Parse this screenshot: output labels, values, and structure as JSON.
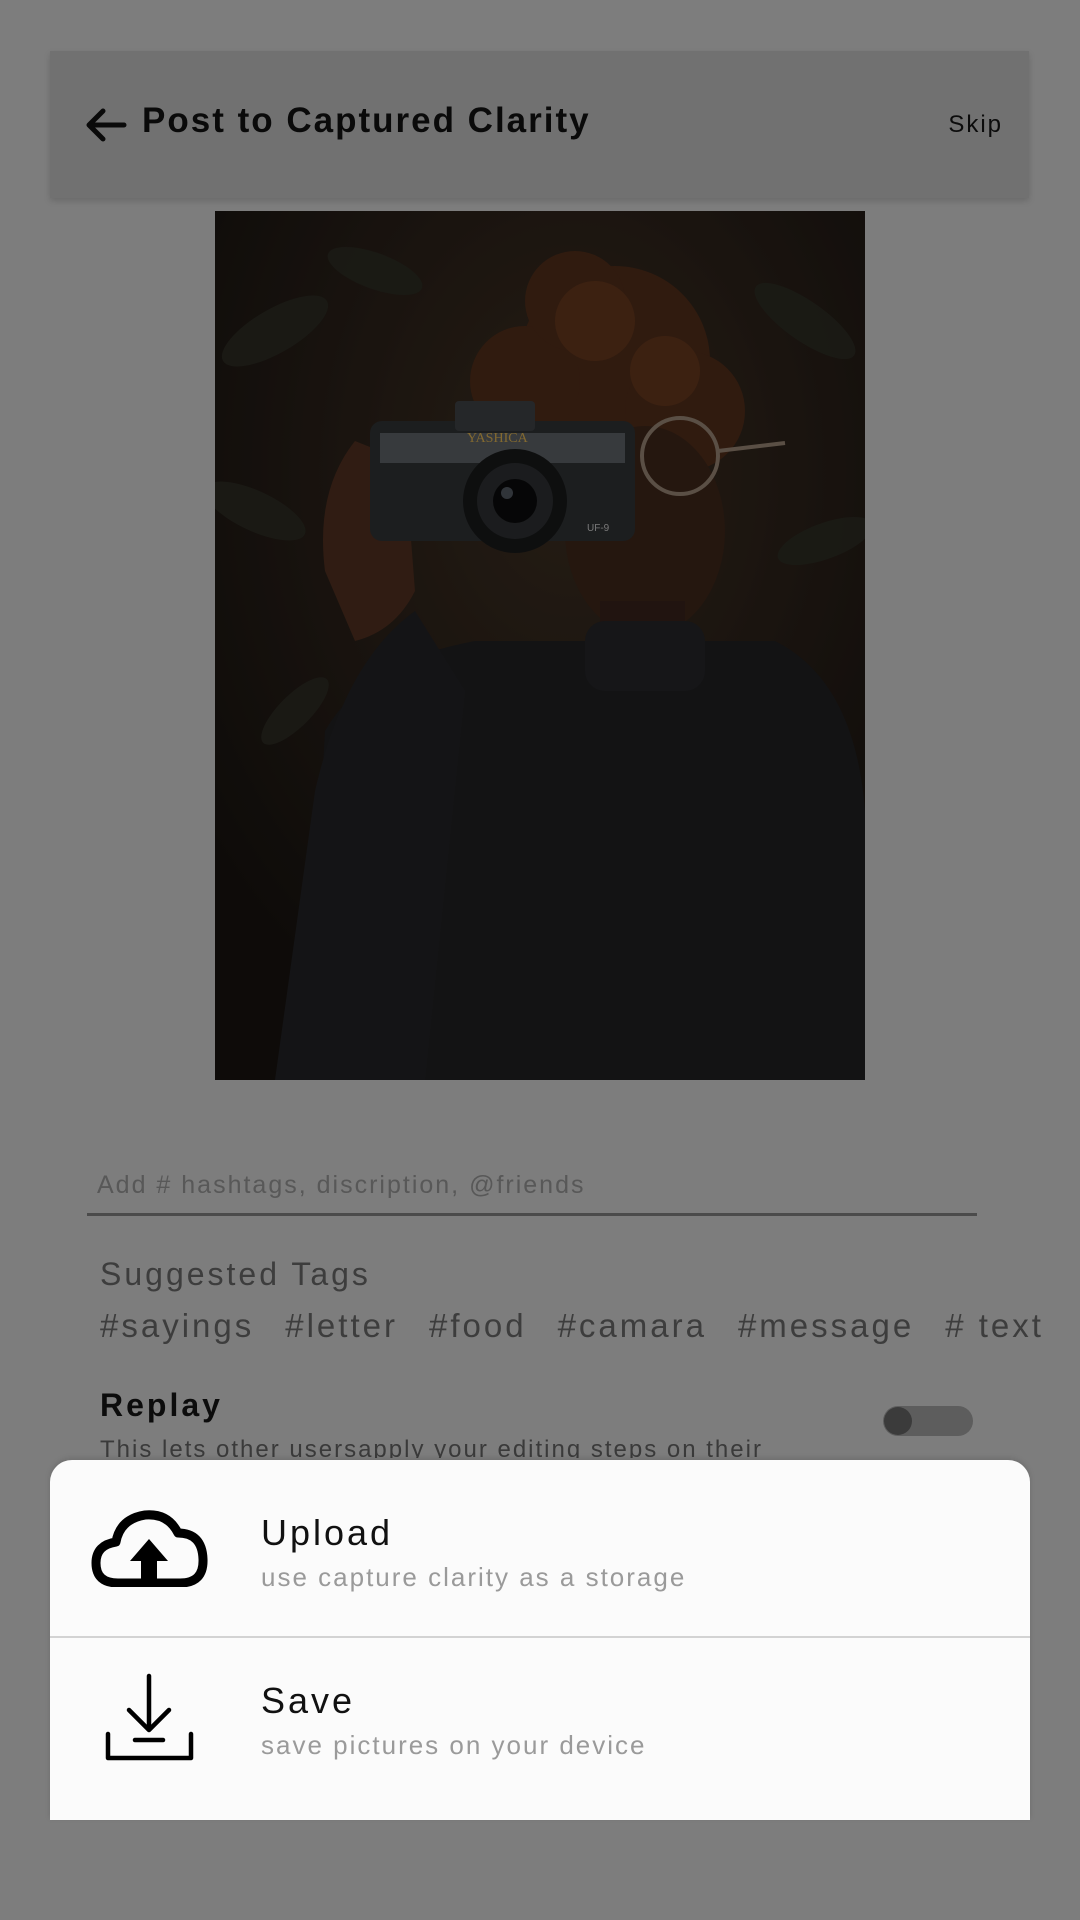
{
  "header": {
    "title": "Post to Captured Clarity",
    "skip_label": "Skip"
  },
  "caption": {
    "placeholder": "Add # hashtags, discription, @friends",
    "value": ""
  },
  "suggested": {
    "title": "Suggested Tags",
    "tags": [
      "#sayings",
      "#letter",
      "#food",
      "#camara",
      "#message",
      "# text"
    ]
  },
  "replay": {
    "title": "Replay",
    "description": "This lets other usersapply your editing steps on their",
    "enabled": false
  },
  "photo": {
    "camera_brand": "YASHICA",
    "camera_model": "UF-9"
  },
  "sheet": {
    "items": [
      {
        "icon": "cloud-upload-icon",
        "title": "Upload",
        "subtitle": "use capture clarity as a storage"
      },
      {
        "icon": "download-icon",
        "title": "Save",
        "subtitle": "save pictures on your device"
      }
    ]
  },
  "colors": {
    "overlay_gray": "#7d7d7d",
    "header_bg": "#717171",
    "sheet_bg": "#fbfbfb",
    "subtitle_gray": "#9a9a9a"
  }
}
